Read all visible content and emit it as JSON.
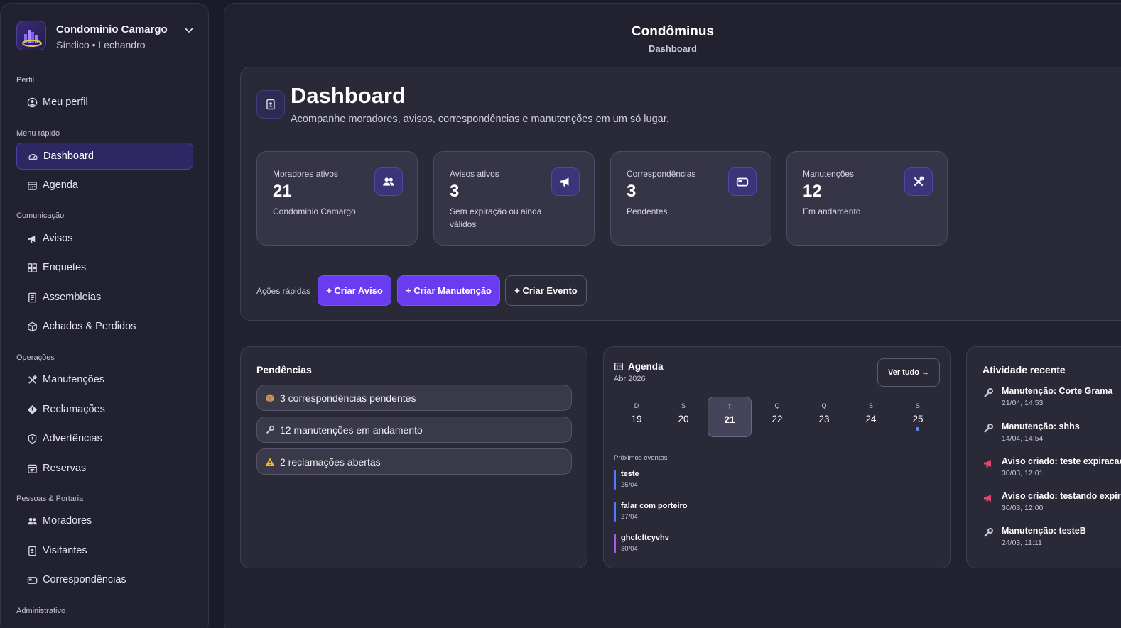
{
  "sidebar": {
    "brand": {
      "name": "Condominio Camargo",
      "subtitle": "Síndico • Lechandro"
    },
    "sections": {
      "perfil": "Perfil",
      "menu_rapido": "Menu rápido",
      "comunicacao": "Comunicação",
      "operacoes": "Operações",
      "pessoas": "Pessoas & Portaria",
      "administrativo": "Administrativo"
    },
    "items": {
      "meu_perfil": "Meu perfil",
      "dashboard": "Dashboard",
      "agenda": "Agenda",
      "avisos": "Avisos",
      "enquetes": "Enquetes",
      "assembleias": "Assembleias",
      "achados": "Achados & Perdidos",
      "manutencoes": "Manutenções",
      "reclamacoes": "Reclamações",
      "advertencias": "Advertências",
      "reservas": "Reservas",
      "moradores": "Moradores",
      "visitantes": "Visitantes",
      "correspondencias": "Correspondências"
    },
    "active_item": "dashboard"
  },
  "header": {
    "title": "Condôminus",
    "subtitle": "Dashboard"
  },
  "hero": {
    "title": "Dashboard",
    "description": "Acompanhe moradores, avisos, correspondências e manutenções em um só lugar."
  },
  "stats": [
    {
      "label": "Moradores ativos",
      "value": "21",
      "desc": "Condominio Camargo",
      "icon": "users-icon"
    },
    {
      "label": "Avisos ativos",
      "value": "3",
      "desc": "Sem expiração ou ainda válidos",
      "icon": "megaphone-icon"
    },
    {
      "label": "Correspondências",
      "value": "3",
      "desc": "Pendentes",
      "icon": "mailbox-icon"
    },
    {
      "label": "Manutenções",
      "value": "12",
      "desc": "Em andamento",
      "icon": "tools-icon"
    }
  ],
  "quick_actions": {
    "label": "Ações rápidas",
    "buttons": [
      "+ Criar Aviso",
      "+ Criar Manutenção",
      "+ Criar Evento"
    ]
  },
  "pendencias": {
    "title": "Pendências",
    "items": [
      "3 correspondências pendentes",
      "12 manutenções em andamento",
      "2 reclamações abertas"
    ]
  },
  "agenda": {
    "title": "Agenda",
    "month": "Abr 2026",
    "see_all": "Ver tudo →",
    "days": [
      {
        "wd": "D",
        "num": "19"
      },
      {
        "wd": "S",
        "num": "20"
      },
      {
        "wd": "T",
        "num": "21",
        "selected": true
      },
      {
        "wd": "Q",
        "num": "22"
      },
      {
        "wd": "Q",
        "num": "23"
      },
      {
        "wd": "S",
        "num": "24"
      },
      {
        "wd": "S",
        "num": "25",
        "has_event": true
      }
    ],
    "next_label": "Próximos eventos",
    "events": [
      {
        "name": "teste",
        "date": "25/04",
        "color": "#4f7dff"
      },
      {
        "name": "falar com porteiro",
        "date": "27/04",
        "color": "#4f7dff"
      },
      {
        "name": "ghcfcftcyvhv",
        "date": "30/04",
        "color": "#a45cf0"
      }
    ]
  },
  "activity": {
    "title": "Atividade recente",
    "items": [
      {
        "title": "Manutenção: Corte Grama",
        "date": "21/04, 14:53",
        "icon": "wrench-icon"
      },
      {
        "title": "Manutenção: shhs",
        "date": "14/04, 14:54",
        "icon": "wrench-icon"
      },
      {
        "title": "Aviso criado: teste expiracao",
        "date": "30/03, 12:01",
        "icon": "megaphone-icon"
      },
      {
        "title": "Aviso criado: testando expiracao",
        "date": "30/03, 12:00",
        "icon": "megaphone-icon"
      },
      {
        "title": "Manutenção: testeB",
        "date": "24/03, 11:11",
        "icon": "wrench-icon"
      }
    ]
  },
  "colors": {
    "accent": "#6a3cf0",
    "background": "#1b1a28",
    "panel": "#2a2938"
  }
}
